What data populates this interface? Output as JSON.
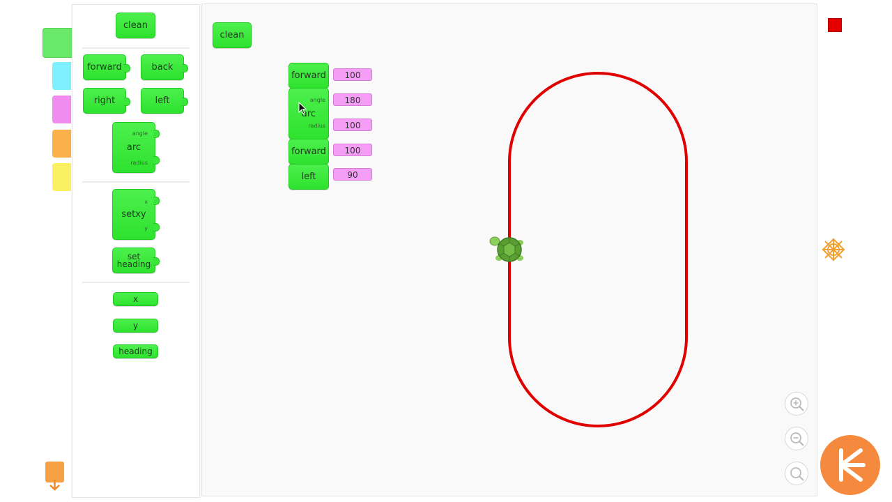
{
  "palette": {
    "clean": "clean",
    "forward": "forward",
    "back": "back",
    "right": "right",
    "left": "left",
    "arc": "arc",
    "arc_angle": "angle",
    "arc_radius": "radius",
    "setxy": "setxy",
    "setxy_x": "x",
    "setxy_y": "y",
    "setheading_line1": "set",
    "setheading_line2": "heading",
    "x": "x",
    "y": "y",
    "heading": "heading"
  },
  "canvas": {
    "clean": "clean",
    "program": [
      {
        "label": "forward",
        "arg": "100"
      },
      {
        "label": "arc",
        "angle_label": "angle",
        "radius_label": "radius",
        "angle": "180",
        "radius": "100"
      },
      {
        "label": "forward",
        "arg": "100"
      },
      {
        "label": "left",
        "arg": "90"
      }
    ]
  },
  "colors": {
    "block_green": "#3ce53c",
    "number_pink": "#f59ef5",
    "path_red": "#e00000",
    "stop_red": "#e50000",
    "logo_orange": "#f58a3e"
  },
  "icons": [
    "stop-icon",
    "grid-icon",
    "zoom-in-icon",
    "zoom-out-icon",
    "zoom-reset-icon",
    "save-icon",
    "turtle-icon",
    "logo-icon",
    "mouse-cursor-icon"
  ]
}
